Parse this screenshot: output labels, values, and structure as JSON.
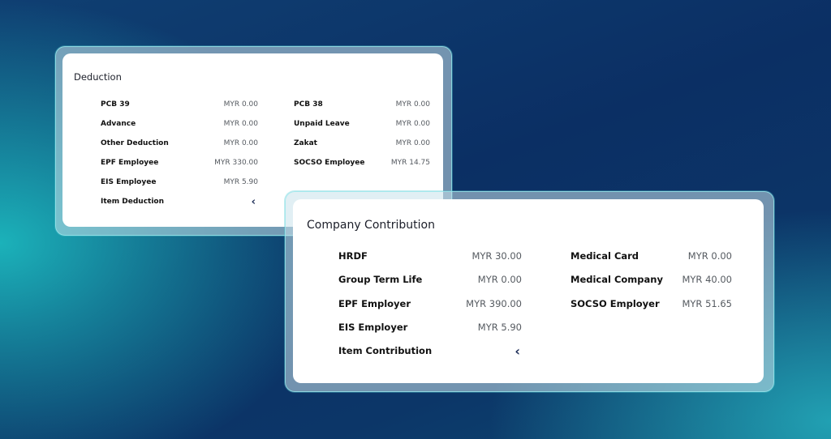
{
  "deduction": {
    "title": "Deduction",
    "left": [
      {
        "label": "PCB 39",
        "value": "MYR 0.00"
      },
      {
        "label": "Advance",
        "value": "MYR 0.00"
      },
      {
        "label": "Other Deduction",
        "value": "MYR 0.00"
      },
      {
        "label": "EPF Employee",
        "value": "MYR 330.00"
      },
      {
        "label": "EIS Employee",
        "value": "MYR 5.90"
      }
    ],
    "right": [
      {
        "label": "PCB 38",
        "value": "MYR 0.00"
      },
      {
        "label": "Unpaid Leave",
        "value": "MYR 0.00"
      },
      {
        "label": "Zakat",
        "value": "MYR 0.00"
      },
      {
        "label": "SOCSO Employee",
        "value": "MYR 14.75"
      }
    ],
    "item_label": "Item Deduction",
    "item_toggle": "‹"
  },
  "contribution": {
    "title": "Company Contribution",
    "left": [
      {
        "label": "HRDF",
        "value": "MYR 30.00"
      },
      {
        "label": "Group Term Life",
        "value": "MYR 0.00"
      },
      {
        "label": "EPF Employer",
        "value": "MYR 390.00"
      },
      {
        "label": "EIS Employer",
        "value": "MYR 5.90"
      }
    ],
    "right": [
      {
        "label": "Medical Card",
        "value": "MYR 0.00"
      },
      {
        "label": "Medical Company",
        "value": "MYR 40.00"
      },
      {
        "label": "SOCSO Employer",
        "value": "MYR 51.65"
      }
    ],
    "item_label": "Item Contribution",
    "item_toggle": "‹"
  }
}
